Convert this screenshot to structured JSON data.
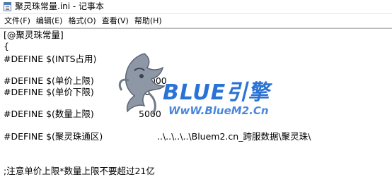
{
  "window": {
    "title": "聚灵珠常量.ini - 记事本"
  },
  "menu": [
    {
      "label": "文件(F)"
    },
    {
      "label": "编辑(E)"
    },
    {
      "label": "格式(O)"
    },
    {
      "label": "查看(V)"
    },
    {
      "label": "帮助(H)"
    }
  ],
  "editor": {
    "lines": [
      "[@聚灵珠常量]",
      "{",
      "#DEFINE $(INTS占用)",
      "#DEFINE $(单价上限)",
      "#DEFINE $(单价下限)",
      "#DEFINE $(数量上限)",
      "#DEFINE $(聚灵珠通区)",
      ";注意单价上限*数量上限不要超过21亿"
    ],
    "values": {
      "ints": "9",
      "price_max": "10000",
      "price_min": "10",
      "qty_max": "5000",
      "path": "..\\..\\..\\..\\Bluem2.cn_跨服数据\\聚灵珠\\"
    }
  },
  "watermark": {
    "brand": "BLUE引擎",
    "url": "WwW.BlueM2.Cn"
  },
  "colors": {
    "accent": "#2a73d6"
  }
}
